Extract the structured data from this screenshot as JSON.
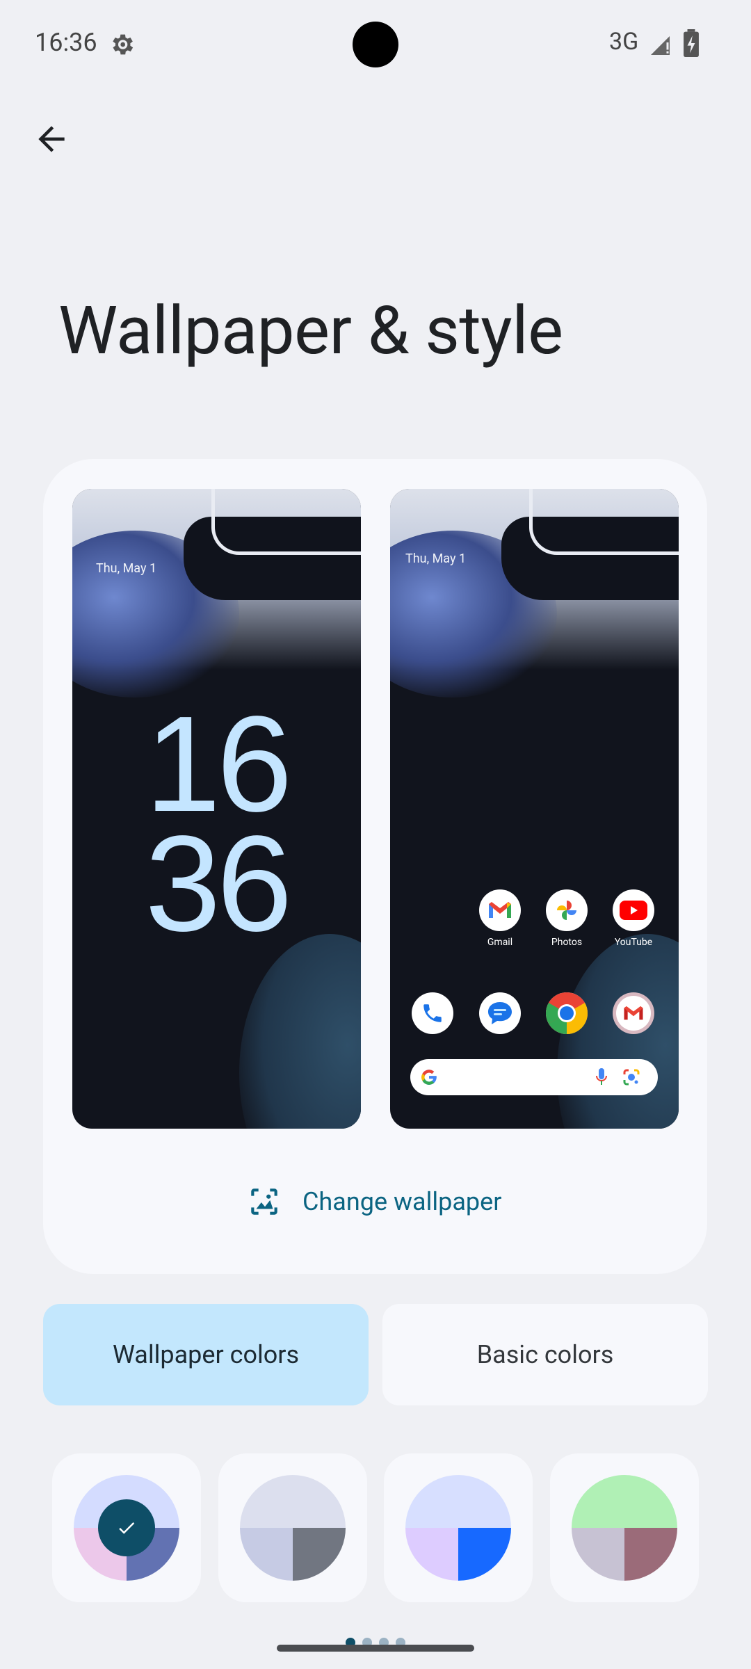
{
  "status_bar": {
    "time": "16:36",
    "network": "3G"
  },
  "page": {
    "title": "Wallpaper & style"
  },
  "preview": {
    "lock_date": "Thu, May 1",
    "lock_hour": "16",
    "lock_minute": "36",
    "home_date": "Thu, May 1",
    "apps": [
      {
        "label": "Gmail",
        "icon": "gmail-icon"
      },
      {
        "label": "Photos",
        "icon": "photos-icon"
      },
      {
        "label": "YouTube",
        "icon": "youtube-icon"
      }
    ],
    "dock": [
      "phone-icon",
      "messages-icon",
      "chrome-icon",
      "gmail-icon"
    ]
  },
  "actions": {
    "change_wallpaper": "Change wallpaper"
  },
  "color_tabs": {
    "wallpaper_colors": "Wallpaper colors",
    "basic_colors": "Basic colors",
    "selected": "Wallpaper colors"
  },
  "swatches": [
    {
      "top": "#d4dcff",
      "bottom_left": "#ecc8ea",
      "bottom_right": "#6272b2",
      "selected": true
    },
    {
      "top": "#dcdfee",
      "bottom_left": "#c6cbe4",
      "bottom_right": "#717681",
      "selected": false
    },
    {
      "top": "#d7dfff",
      "bottom_left": "#ddccff",
      "bottom_right": "#1769ff",
      "selected": false
    },
    {
      "top": "#b0f0b5",
      "bottom_left": "#c7c2d3",
      "bottom_right": "#9b6b79",
      "selected": false
    }
  ],
  "pager": {
    "count": 4,
    "active": 1
  }
}
